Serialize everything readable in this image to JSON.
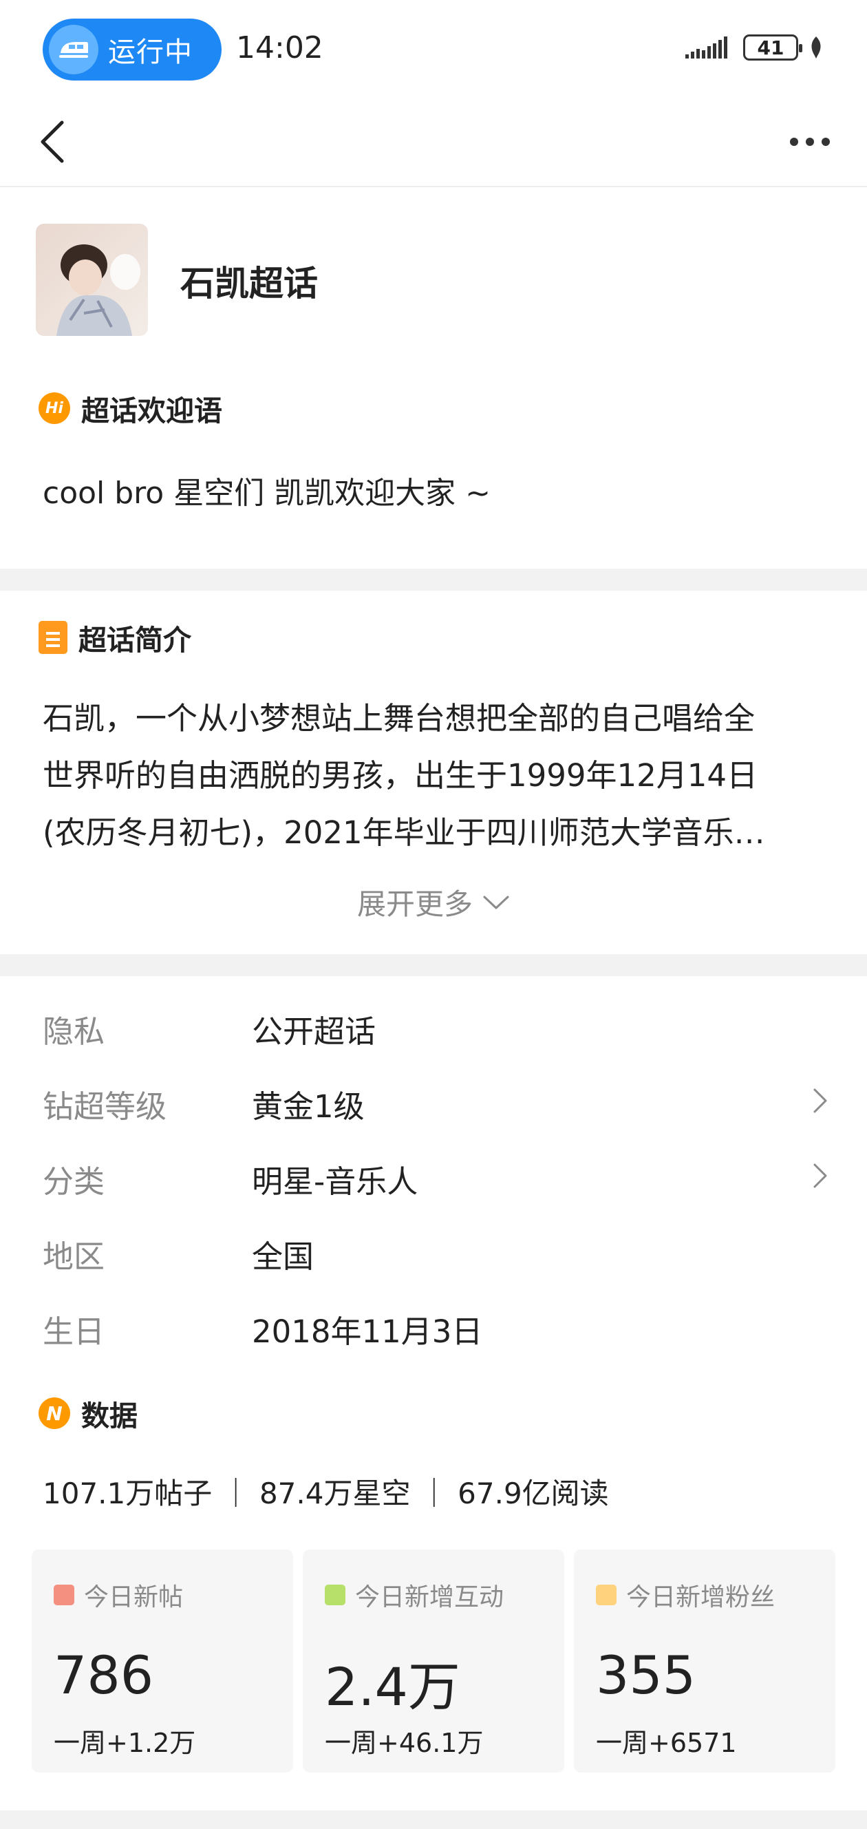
{
  "status_bar": {
    "run_label": "运行中",
    "time": "14:02",
    "battery": "41"
  },
  "header": {
    "topic_name": "石凯超话"
  },
  "welcome": {
    "title": "超话欢迎语",
    "icon_text": "Hi",
    "text": "cool bro 星空们 凯凯欢迎大家 ~"
  },
  "intro": {
    "title": "超话简介",
    "lines": [
      "石凯，一个从小梦想站上舞台想把全部的自己唱给全",
      "世界听的自由洒脱的男孩，出生于1999年12月14日",
      "(农历冬月初七)，2021年毕业于四川师范大学音乐…"
    ],
    "expand_label": "展开更多"
  },
  "info": [
    {
      "key": "隐私",
      "value": "公开超话",
      "has_arrow": false
    },
    {
      "key": "钻超等级",
      "value": "黄金1级",
      "has_arrow": true
    },
    {
      "key": "分类",
      "value": "明星-音乐人",
      "has_arrow": true
    },
    {
      "key": "地区",
      "value": "全国",
      "has_arrow": false
    },
    {
      "key": "生日",
      "value": "2018年11月3日",
      "has_arrow": false
    }
  ],
  "data_section": {
    "title": "数据",
    "summary": "107.1万帖子 ｜ 87.4万星空 ｜ 67.9亿阅读",
    "cards": [
      {
        "label": "今日新帖",
        "value": "786",
        "week": "一周+1.2万",
        "color": "#f4907f"
      },
      {
        "label": "今日新增互动",
        "value": "2.4万",
        "week": "一周+46.1万",
        "color": "#b6e06a"
      },
      {
        "label": "今日新增粉丝",
        "value": "355",
        "week": "一周+6571",
        "color": "#ffd27d"
      }
    ]
  }
}
